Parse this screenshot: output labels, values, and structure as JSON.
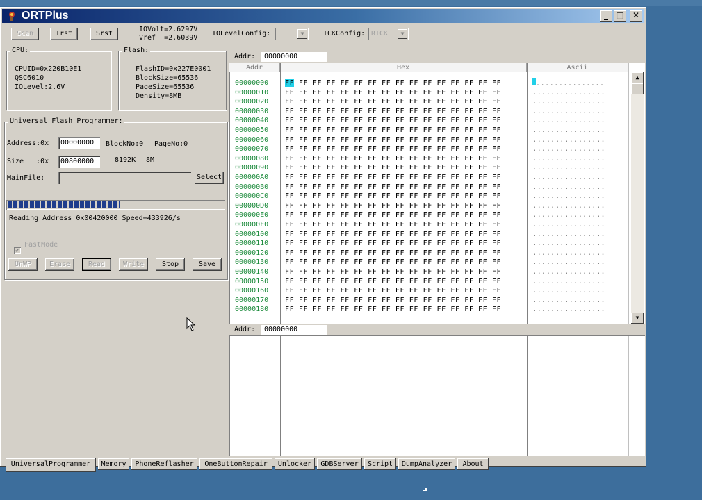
{
  "window": {
    "title": "ORTPlus",
    "minimize": "_",
    "maximize": "□",
    "close": "✕"
  },
  "toolbar": {
    "scan": "Scan",
    "trst": "Trst",
    "srst": "Srst",
    "iovolt": "IOVolt=2.6297V",
    "vref": "Vref  =2.6039V",
    "iolevel_label": "IOLevelConfig:",
    "iolevel_value": "",
    "tck_label": "TCKConfig:",
    "tck_value": "RTCK"
  },
  "cpu": {
    "title": "CPU:",
    "cpuid": "CPUID=0x220B10E1",
    "chip": "QSC6010",
    "iolevel": "IOLevel:2.6V"
  },
  "flash": {
    "title": "Flash:",
    "flashid": "FlashID=0x227E0001",
    "blocksize": "BlockSize=65536",
    "pagesize": "PageSize=65536",
    "density": "Density=8MB"
  },
  "programmer": {
    "title": "Universal Flash Programmer:",
    "address_label": "Address:0x",
    "address_value": "00000000",
    "blockno": "BlockNo:0",
    "pageno": "PageNo:0",
    "size_label": "Size   :0x",
    "size_value": "00800000",
    "size_k": "8192K",
    "size_m": "8M",
    "mainfile_label": "MainFile:",
    "mainfile_value": "",
    "select": "Select",
    "progress": 0.52,
    "status": "Reading Address 0x00420000 Speed=433926/s",
    "fastmode": "FastMode",
    "buttons": {
      "unwp": "UnWP",
      "erase": "Erase",
      "read": "Read",
      "write": "Write",
      "stop": "Stop",
      "save": "Save"
    }
  },
  "hexview": {
    "addr_label": "Addr:",
    "addr_value": "00000000",
    "col_addr": "Addr",
    "col_hex": "Hex",
    "col_ascii": "Ascii",
    "bottom_addr_label": "Addr:",
    "bottom_addr_value": "00000000",
    "first_byte": "FF",
    "rest_first_row": " FF FF FF FF FF FF FF FF FF FF FF FF FF FF FF",
    "hex_row": "FF FF FF FF FF FF FF FF FF FF FF FF FF FF FF FF",
    "ascii_first_rest": "...............",
    "ascii_row": "................",
    "rows": [
      "00000000",
      "00000010",
      "00000020",
      "00000030",
      "00000040",
      "00000050",
      "00000060",
      "00000070",
      "00000080",
      "00000090",
      "000000A0",
      "000000B0",
      "000000C0",
      "000000D0",
      "000000E0",
      "000000F0",
      "00000100",
      "00000110",
      "00000120",
      "00000130",
      "00000140",
      "00000150",
      "00000160",
      "00000170",
      "00000180"
    ]
  },
  "tabs": [
    "UniversalProgrammer",
    "Memory",
    "PhoneReflasher",
    "OneButtonRepair",
    "Unlocker",
    "GDBServer",
    "Script",
    "DumpAnalyzer",
    "About"
  ],
  "colors": {
    "titlebar": "#0a246a",
    "progress": "#1e3c8c",
    "address": "#1a8a3a",
    "highlight": "#22d0e8",
    "desktop": "#3d6e9c"
  }
}
